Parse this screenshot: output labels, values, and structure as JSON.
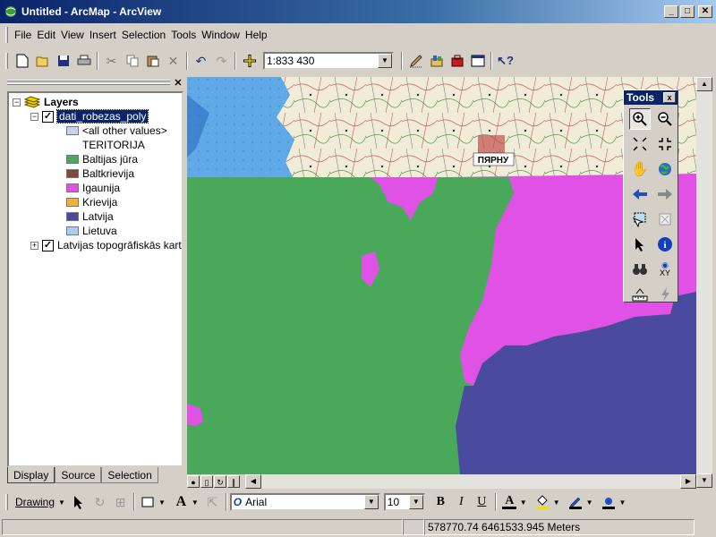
{
  "window": {
    "title": "Untitled - ArcMap - ArcView",
    "minimize": "_",
    "maximize": "□",
    "close": "✕"
  },
  "menu": [
    "File",
    "Edit",
    "View",
    "Insert",
    "Selection",
    "Tools",
    "Window",
    "Help"
  ],
  "toolbar": {
    "scale": "1:833 430"
  },
  "toc": {
    "root_label": "Layers",
    "layers": [
      {
        "name": "dati_robezas_poly",
        "checked": true,
        "expanded": true,
        "legend_header_values": [
          "<all other values>",
          "TERITORIJA"
        ],
        "legend": [
          {
            "label": "Baltijas jūra",
            "color": "#4aa85a"
          },
          {
            "label": "Baltkrievija",
            "color": "#7d4a3c"
          },
          {
            "label": "Igaunija",
            "color": "#e052e6"
          },
          {
            "label": "Krievija",
            "color": "#f0b233"
          },
          {
            "label": "Latvija",
            "color": "#4a4a9e"
          },
          {
            "label": "Lietuva",
            "color": "#a6cff0"
          }
        ]
      },
      {
        "name": "Latvijas topogrāfiskās kart",
        "checked": true,
        "expanded": false
      }
    ],
    "tabs": [
      "Display",
      "Source",
      "Selection"
    ],
    "active_tab": "Display"
  },
  "map": {
    "raster_label": "ПЯРНУ",
    "sea_color": "#4aa85a",
    "estonia_color": "#e052e6",
    "latvia_color": "#4a4a9e",
    "water_color": "#5fa9e6"
  },
  "tools_palette": {
    "title": "Tools",
    "close": "x",
    "xy_label": "XY"
  },
  "drawing": {
    "label": "Drawing",
    "font": "Arial",
    "font_size": "10",
    "bold": "B",
    "italic": "I",
    "underline": "U",
    "font_color_glyph": "A"
  },
  "status": {
    "coordinates": "578770.74  6461533.945 Meters"
  }
}
